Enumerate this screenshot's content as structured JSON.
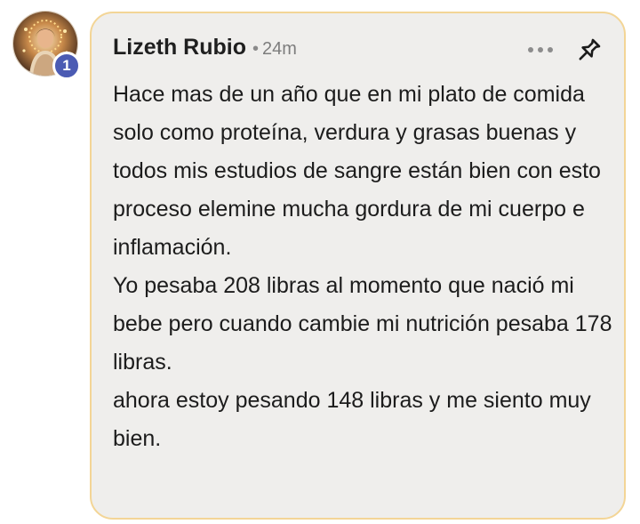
{
  "comment": {
    "avatar_badge": "1",
    "author": "Lizeth Rubio",
    "separator": "•",
    "time": "24m",
    "more_icon": "more-horizontal-icon",
    "pin_icon": "pin-icon",
    "body": "Hace mas de un año que en mi plato de comida solo como proteína, verdura y grasas buenas y todos mis estudios de sangre están bien con esto proceso elemine mucha gordura de mi cuerpo e inflamación.\nYo pesaba 208 libras al momento que nació mi bebe pero cuando cambie mi nutrición pesaba 178 libras.\nahora estoy pesando 148 libras y me siento muy bien.",
    "colors": {
      "bubble_bg": "#efeeec",
      "bubble_border": "#f3d596",
      "badge": "#4b5bb3",
      "text": "#1c1c1c"
    }
  }
}
